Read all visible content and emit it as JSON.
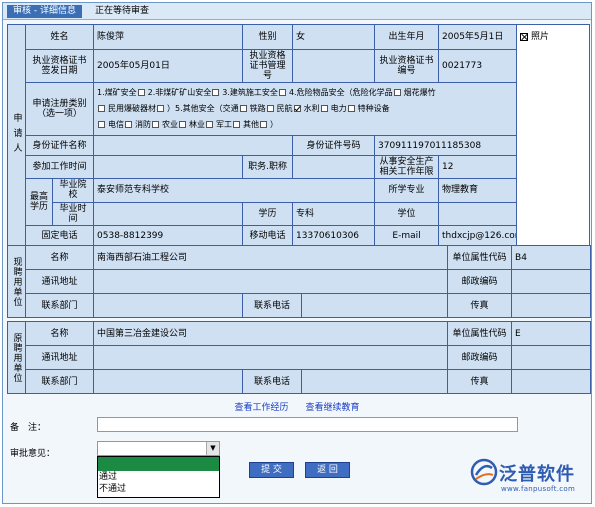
{
  "titlebar": {
    "tab": "审核 - 详细信息",
    "status": "正在等待审查"
  },
  "applicant": {
    "side_label": "申请人",
    "name_label": "姓名",
    "name": "陈俊萍",
    "gender_label": "性别",
    "gender": "女",
    "birth_label": "出生年月",
    "birth": "2005年5月1日",
    "photo_label": "照片",
    "cert_date_label": "执业资格证书签发日期",
    "cert_date": "2005年05月01日",
    "cert_mgmt_label": "执业资格证书管理号",
    "cert_mgmt": "",
    "cert_no_label": "执业资格证书编号",
    "cert_no": "0021773",
    "category_label": "申请注册类别（选一项）",
    "category_line1": "1.煤矿安全",
    "category_line1b": "2.非煤矿矿山安全",
    "category_line1c": "3.建筑施工安全",
    "category_line1d": "4.危险物品安全（危险化学品",
    "category_line1e": "烟花爆竹",
    "category_line2a": "民用爆破器材",
    "category_line2b": "）5.其他安全（交通",
    "category_line2c": "铁路",
    "category_line2d": "民航",
    "category_line2e": "水利",
    "category_line2f": "电力",
    "category_line2g": "特种设备",
    "category_line3a": "电信",
    "category_line3b": "消防",
    "category_line3c": "农业",
    "category_line3d": "林业",
    "category_line3e": "军工",
    "category_line3f": "其他",
    "category_line3g": "）",
    "idcard_type_label": "身份证件名称",
    "idcard_type": "",
    "idcard_no_label": "身份证件号码",
    "idcard_no": "370911197011185308",
    "work_start_label": "参加工作时间",
    "work_start": "",
    "title_label": "职务.职称",
    "title": "",
    "safety_years_label": "从事安全生产相关工作年限",
    "safety_years": "12",
    "edu_label": "最高学历",
    "school_label": "毕业院校",
    "school": "泰安师范专科学校",
    "major_label": "所学专业",
    "major": "物理教育",
    "grad_time_label": "毕业时间",
    "grad_time": "",
    "degree_edu_label": "学历",
    "degree_edu": "专科",
    "degree_label": "学位",
    "degree": "",
    "phone_label": "固定电话",
    "phone": "0538-8812399",
    "mobile_label": "移动电话",
    "mobile": "13370610306",
    "email_label": "E-mail",
    "email": "thdxcjp@126.com"
  },
  "current_employer": {
    "side_label": "现聘用单位",
    "name_label": "名称",
    "name": "南海西部石油工程公司",
    "nature_label": "单位属性代码",
    "nature": "B4",
    "address_label": "通讯地址",
    "address": "",
    "zip_label": "邮政编码",
    "zip": "",
    "dept_label": "联系部门",
    "dept": "",
    "tel_label": "联系电话",
    "tel": "",
    "fax_label": "传真",
    "fax": ""
  },
  "previous_employer": {
    "side_label": "原聘用单位",
    "name_label": "名称",
    "name": "中国第三冶金建设公司",
    "nature_label": "单位属性代码",
    "nature": "E",
    "address_label": "通讯地址",
    "address": "",
    "zip_label": "邮政编码",
    "zip": "",
    "dept_label": "联系部门",
    "dept": "",
    "tel_label": "联系电话",
    "tel": "",
    "fax_label": "传真",
    "fax": ""
  },
  "links": {
    "work_history": "查看工作经历",
    "continuing_edu": "查看继续教育"
  },
  "form": {
    "remark_label": "备　注：",
    "remark_value": "",
    "approval_label": "审批意见：",
    "approval_selected": "",
    "options": [
      "",
      "通过",
      "不通过"
    ],
    "submit": "提 交",
    "back": "返 回"
  },
  "logo": {
    "text": "泛普软件",
    "url": "www.fanpusoft.com",
    "color": "#2f5bb0"
  }
}
